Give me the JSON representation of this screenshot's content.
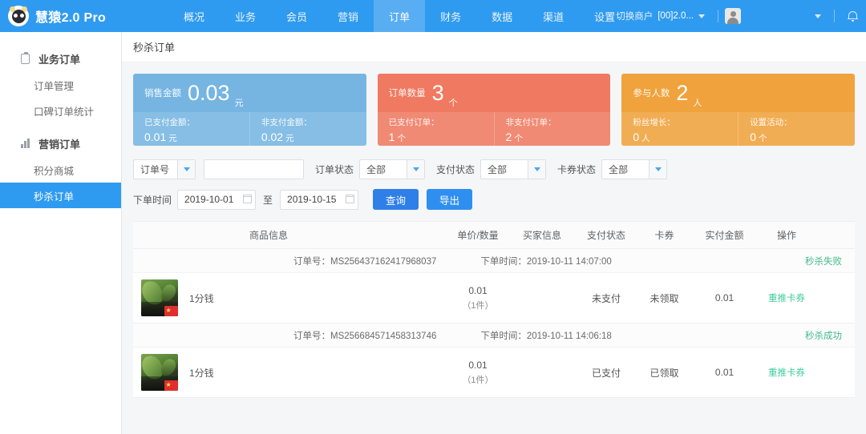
{
  "header": {
    "brand": "慧猿2.0 Pro",
    "nav": [
      {
        "label": "概况",
        "active": false
      },
      {
        "label": "业务",
        "active": false
      },
      {
        "label": "会员",
        "active": false
      },
      {
        "label": "营销",
        "active": false
      },
      {
        "label": "订单",
        "active": true
      },
      {
        "label": "财务",
        "active": false
      },
      {
        "label": "数据",
        "active": false
      },
      {
        "label": "渠道",
        "active": false
      },
      {
        "label": "设置",
        "active": false
      }
    ],
    "switch_merchant_label": "切换商户",
    "merchant_value": "[00]2.0...",
    "avatar_icon": "user-avatar-icon",
    "bell_icon": "bell-icon",
    "chevron_icon": "chevron-down-icon"
  },
  "sidebar": {
    "groups": [
      {
        "label": "业务订单",
        "icon": "clipboard-icon",
        "items": [
          {
            "label": "订单管理",
            "active": false
          },
          {
            "label": "口碑订单统计",
            "active": false
          }
        ]
      },
      {
        "label": "营销订单",
        "icon": "bar-chart-icon",
        "items": [
          {
            "label": "积分商城",
            "active": false
          },
          {
            "label": "秒杀订单",
            "active": true
          }
        ]
      }
    ]
  },
  "page": {
    "title": "秒杀订单"
  },
  "cards": [
    {
      "color": "#76b5e2",
      "label": "销售金额",
      "value": "0.03",
      "unit": "元",
      "sub": [
        {
          "label": "已支付金额：",
          "value": "0.01",
          "unit": "元"
        },
        {
          "label": "非支付金额：",
          "value": "0.02",
          "unit": "元"
        }
      ]
    },
    {
      "color": "#f07a61",
      "label": "订单数量",
      "value": "3",
      "unit": "个",
      "sub": [
        {
          "label": "已支付订单：",
          "value": "1",
          "unit": "个"
        },
        {
          "label": "非支付订单：",
          "value": "2",
          "unit": "个"
        }
      ]
    },
    {
      "color": "#f0a23c",
      "label": "参与人数",
      "value": "2",
      "unit": "人",
      "sub": [
        {
          "label": "粉丝增长：",
          "value": "0",
          "unit": "人"
        },
        {
          "label": "设置活动：",
          "value": "0",
          "unit": "个"
        }
      ]
    }
  ],
  "filters": {
    "search_type": "订单号",
    "search_value": "",
    "search_placeholder": "",
    "order_status_label": "订单状态",
    "order_status_value": "全部",
    "pay_status_label": "支付状态",
    "pay_status_value": "全部",
    "card_status_label": "卡券状态",
    "card_status_value": "全部",
    "date_label": "下单时间",
    "date_start": "2019-10-01",
    "date_to": "至",
    "date_end": "2019-10-15",
    "query_button": "查询",
    "export_button": "导出"
  },
  "table": {
    "headers": {
      "goods": "商品信息",
      "price": "单价/数量",
      "buyer": "买家信息",
      "pay": "支付状态",
      "card": "卡券",
      "amount": "实付金额",
      "action": "操作"
    },
    "order_no_prefix": "订单号：",
    "order_time_prefix": "下单时间：",
    "orders": [
      {
        "order_no": "MS256437162417968037",
        "order_time": "2019-10-11 14:07:00",
        "status": "秒杀失败",
        "goods_name": "1分钱",
        "price": "0.01",
        "qty": "（1件）",
        "buyer": "",
        "pay_status": "未支付",
        "card_status": "未领取",
        "amount": "0.01",
        "action": "重推卡券"
      },
      {
        "order_no": "MS256684571458313746",
        "order_time": "2019-10-11 14:06:18",
        "status": "秒杀成功",
        "goods_name": "1分钱",
        "price": "0.01",
        "qty": "（1件）",
        "buyer": "",
        "pay_status": "已支付",
        "card_status": "已领取",
        "amount": "0.01",
        "action": "重推卡券"
      }
    ]
  }
}
